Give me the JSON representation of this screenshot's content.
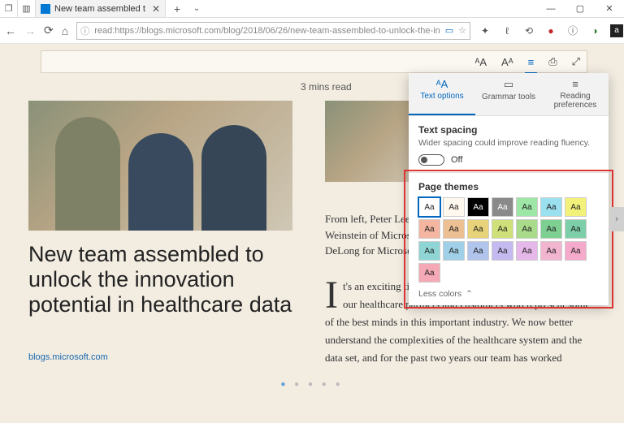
{
  "window": {
    "min": "—",
    "max": "▢",
    "close": "✕"
  },
  "tab": {
    "title": "New team assembled t",
    "close": "✕",
    "plus": "+",
    "chevron": "⌄"
  },
  "addr": {
    "url": "read:https://blogs.microsoft.com/blog/2018/06/26/new-team-assembled-to-unlock-the-in",
    "lock": "ⓘ",
    "book": "▭",
    "star": "☆"
  },
  "nav": {
    "back": "←",
    "fwd": "→",
    "refresh": "⟳",
    "home": "⌂"
  },
  "ext": [
    "✦",
    "ℓ",
    "⟲",
    "●",
    "ⓘ",
    "◑",
    "a",
    "◐",
    "▦",
    "⋯"
  ],
  "toolbar": {
    "learning": "ᴬA",
    "textsize": "Aᴬ",
    "options": "≡",
    "print": "⎙",
    "full": "⤢"
  },
  "article": {
    "readtime": "3 mins read",
    "headline": "New team assembled to unlock the innovation potential in healthcare data",
    "source": "blogs.microsoft.com",
    "caption": "From left, Peter Lee, Joshua Mandel, Jim Weinstein of Microsoft and Greg Moore from DeLong for Microsoft.",
    "body_first": "I",
    "body_rest": "t's an exciting time — working shoulder to shoulder with our healthcare partners and customers who represent some of the best minds in this important industry. We now better understand the complexities of the healthcare system and the data set, and for the past two years our team has worked"
  },
  "panel": {
    "tabs": {
      "text": "Text options",
      "grammar": "Grammar tools",
      "reading": "Reading preferences"
    },
    "spacing": {
      "title": "Text spacing",
      "sub": "Wider spacing could improve reading fluency.",
      "state": "Off"
    },
    "themes": {
      "title": "Page themes",
      "sample": "Aa",
      "less": "Less colors",
      "chev": "⌃"
    },
    "swatches": [
      {
        "bg": "#ffffff",
        "fg": "#222",
        "sel": true
      },
      {
        "bg": "#fff8ef",
        "fg": "#222"
      },
      {
        "bg": "#000000",
        "fg": "#fff"
      },
      {
        "bg": "#8a8a8a",
        "fg": "#fff"
      },
      {
        "bg": "#9ee6a5",
        "fg": "#222"
      },
      {
        "bg": "#9ae0ef",
        "fg": "#222"
      },
      {
        "bg": "#f2f27a",
        "fg": "#222"
      },
      {
        "bg": "#f4b6a0",
        "fg": "#222"
      },
      {
        "bg": "#edc093",
        "fg": "#222"
      },
      {
        "bg": "#e8d37b",
        "fg": "#222"
      },
      {
        "bg": "#cfe07a",
        "fg": "#222"
      },
      {
        "bg": "#a9db8a",
        "fg": "#222"
      },
      {
        "bg": "#7ecf92",
        "fg": "#222"
      },
      {
        "bg": "#7ccfa9",
        "fg": "#222"
      },
      {
        "bg": "#8fd5d5",
        "fg": "#222"
      },
      {
        "bg": "#9fd0e8",
        "fg": "#222"
      },
      {
        "bg": "#b0c4ec",
        "fg": "#222"
      },
      {
        "bg": "#c4baf0",
        "fg": "#222"
      },
      {
        "bg": "#e6b8ea",
        "fg": "#222"
      },
      {
        "bg": "#f2b5d0",
        "fg": "#222"
      },
      {
        "bg": "#f5aacb",
        "fg": "#222"
      },
      {
        "bg": "#f5a9b6",
        "fg": "#222"
      }
    ]
  }
}
